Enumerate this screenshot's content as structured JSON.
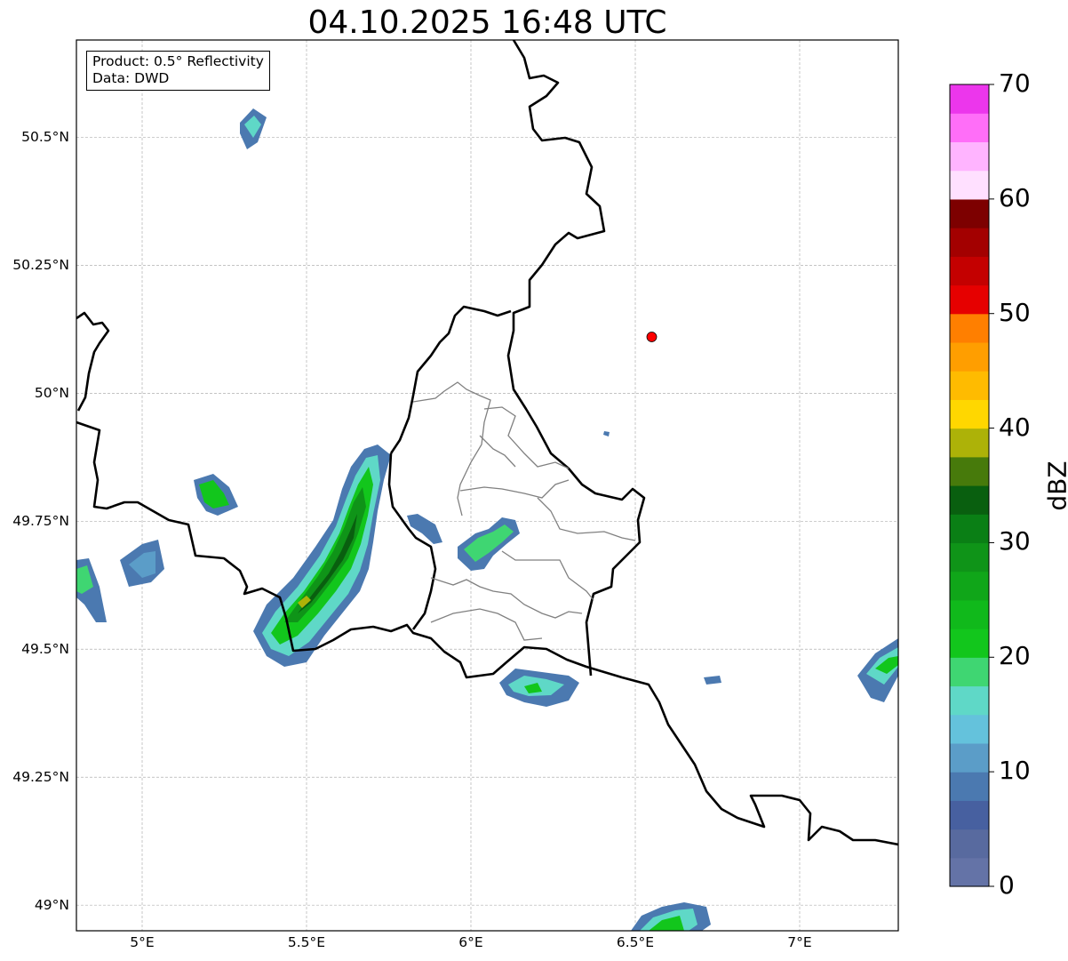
{
  "title": "04.10.2025 16:48 UTC",
  "info": {
    "product": "Product: 0.5° Reflectivity",
    "data": "Data: DWD"
  },
  "map": {
    "lon_range": [
      4.8,
      7.3
    ],
    "lat_range": [
      48.95,
      50.69
    ],
    "lon_ticks": [
      {
        "value": 5.0,
        "label": "5°E"
      },
      {
        "value": 5.5,
        "label": "5.5°E"
      },
      {
        "value": 6.0,
        "label": "6°E"
      },
      {
        "value": 6.5,
        "label": "6.5°E"
      },
      {
        "value": 7.0,
        "label": "7°E"
      }
    ],
    "lat_ticks": [
      {
        "value": 50.5,
        "label": "50.5°N"
      },
      {
        "value": 50.25,
        "label": "50.25°N"
      },
      {
        "value": 50.0,
        "label": "50°N"
      },
      {
        "value": 49.75,
        "label": "49.75°N"
      },
      {
        "value": 49.5,
        "label": "49.5°N"
      },
      {
        "value": 49.25,
        "label": "49.25°N"
      },
      {
        "value": 49.0,
        "label": "49°N"
      }
    ],
    "radar_site": {
      "lon": 6.55,
      "lat": 50.11,
      "color": "#ff0000"
    },
    "borders_color": "#000000",
    "admin_color": "#808080",
    "grid": true
  },
  "colorbar": {
    "label": "dBZ",
    "min": 0,
    "max": 70,
    "ticks": [
      "0",
      "10",
      "20",
      "30",
      "40",
      "50",
      "60",
      "70"
    ],
    "colors": [
      "#6473a7",
      "#586a9f",
      "#4760a0",
      "#4b79b0",
      "#5b9dc8",
      "#64c2dc",
      "#5fd8c7",
      "#3fd672",
      "#12c61c",
      "#10b91b",
      "#10a619",
      "#0f9418",
      "#0a7f15",
      "#095f0f",
      "#477a0b",
      "#adb208",
      "#ffd700",
      "#ffbb00",
      "#ff9e00",
      "#ff7f00",
      "#e60000",
      "#c40000",
      "#a30000",
      "#7d0000",
      "#ffe0ff",
      "#ffb4ff",
      "#ff6ef8",
      "#ec36ec"
    ]
  }
}
